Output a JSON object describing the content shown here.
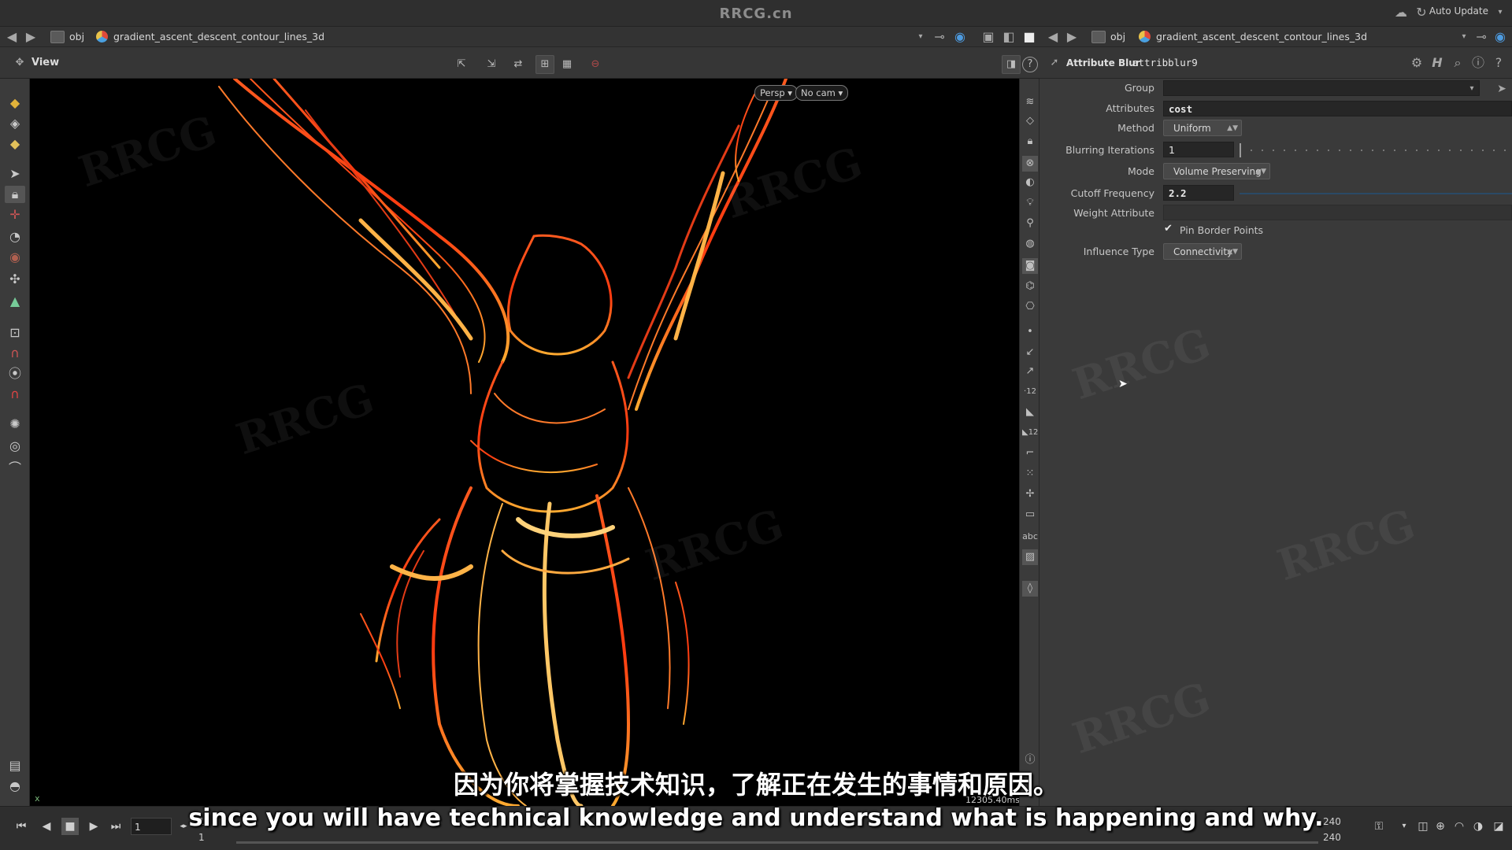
{
  "app": {
    "title": "RRCG.cn",
    "auto_update": "Auto Update"
  },
  "left_path": {
    "network": "obj",
    "node": "gradient_ascent_descent_contour_lines_3d"
  },
  "right_path": {
    "network": "obj",
    "node": "gradient_ascent_descent_contour_lines_3d"
  },
  "viewer": {
    "label": "View",
    "camera_mode": "Persp",
    "camera": "No cam",
    "stats": "12305.40ms"
  },
  "node": {
    "type_label": "Attribute Blur",
    "name": "attribblur9"
  },
  "params": {
    "group": {
      "label": "Group",
      "value": ""
    },
    "attributes": {
      "label": "Attributes",
      "value": "cost"
    },
    "method": {
      "label": "Method",
      "value": "Uniform"
    },
    "blurring_iterations": {
      "label": "Blurring Iterations",
      "value": "1"
    },
    "mode": {
      "label": "Mode",
      "value": "Volume Preserving"
    },
    "cutoff_frequency": {
      "label": "Cutoff Frequency",
      "value": "2.2"
    },
    "weight_attribute": {
      "label": "Weight Attribute",
      "value": ""
    },
    "pin_border_points": {
      "label": "Pin Border Points",
      "checked": true
    },
    "influence_type": {
      "label": "Influence Type",
      "value": "Connectivity"
    }
  },
  "timeline": {
    "current_frame": "1",
    "start_top": "1",
    "start_bottom": "1",
    "end_top": "240",
    "end_bottom": "240"
  },
  "subtitles": {
    "zh": "因为你将掌握技术知识，了解正在发生的事情和原因。",
    "en": "since you will have technical knowledge and understand what is happening and why."
  },
  "watermark_text": "RRCG",
  "icons": {
    "back": "back-arrow-icon",
    "forward": "forward-arrow-icon",
    "pin": "pin-icon",
    "settings": "gear-icon",
    "help": "help-icon",
    "info": "info-icon",
    "search": "search-icon"
  },
  "colors": {
    "accent": "#e9a13a",
    "viewport_bg": "#000000",
    "panel_bg": "#3a3a3a"
  }
}
